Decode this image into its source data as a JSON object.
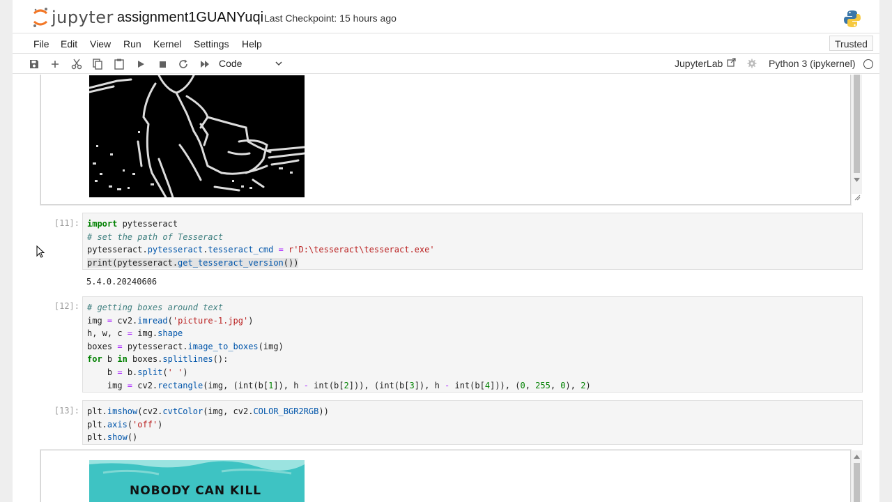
{
  "header": {
    "logo_text": "jupyter",
    "notebook_name": "assignment1GUANYuqi",
    "checkpoint": "Last Checkpoint: 15 hours ago",
    "python_logo_icon": "python-logo-icon"
  },
  "menu": {
    "items": [
      "File",
      "Edit",
      "View",
      "Run",
      "Kernel",
      "Settings",
      "Help"
    ],
    "trusted": "Trusted"
  },
  "toolbar": {
    "icons": [
      "save-icon",
      "add-cell-icon",
      "cut-icon",
      "copy-icon",
      "paste-icon",
      "run-icon",
      "stop-icon",
      "restart-icon",
      "fast-forward-icon"
    ],
    "cell_type": "Code",
    "jupyterlab_link": "JupyterLab",
    "kernel_name": "Python 3 (ipykernel)"
  },
  "cells": [
    {
      "prompt": "[11]:",
      "lines": [
        "import pytesseract",
        "# set the path of Tesseract",
        "pytesseract.pytesseract.tesseract_cmd = r'D:\\tesseract\\tesseract.exe'",
        "print(pytesseract.get_tesseract_version())"
      ],
      "output": "5.4.0.20240606"
    },
    {
      "prompt": "[12]:",
      "lines": [
        "# getting boxes around text",
        "img = cv2.imread('picture-1.jpg')",
        "h, w, c = img.shape",
        "boxes = pytesseract.image_to_boxes(img)",
        "for b in boxes.splitlines():",
        "    b = b.split(' ')",
        "    img = cv2.rectangle(img, (int(b[1]), h - int(b[2])), (int(b[3]), h - int(b[4])), (0, 255, 0), 2)"
      ]
    },
    {
      "prompt": "[13]:",
      "lines": [
        "plt.imshow(cv2.cvtColor(img, cv2.COLOR_BGR2RGB))",
        "plt.axis('off')",
        "plt.show()"
      ]
    }
  ],
  "outputs": {
    "edge_image_description": "edge-detected-image",
    "comic_image_text": "NOBODY CAN KILL"
  },
  "colors": {
    "keyword": "#008000",
    "comment": "#408080",
    "string": "#ba2121",
    "cell_bg": "#f5f5f5",
    "comic_bg": "#3ec3c3"
  }
}
